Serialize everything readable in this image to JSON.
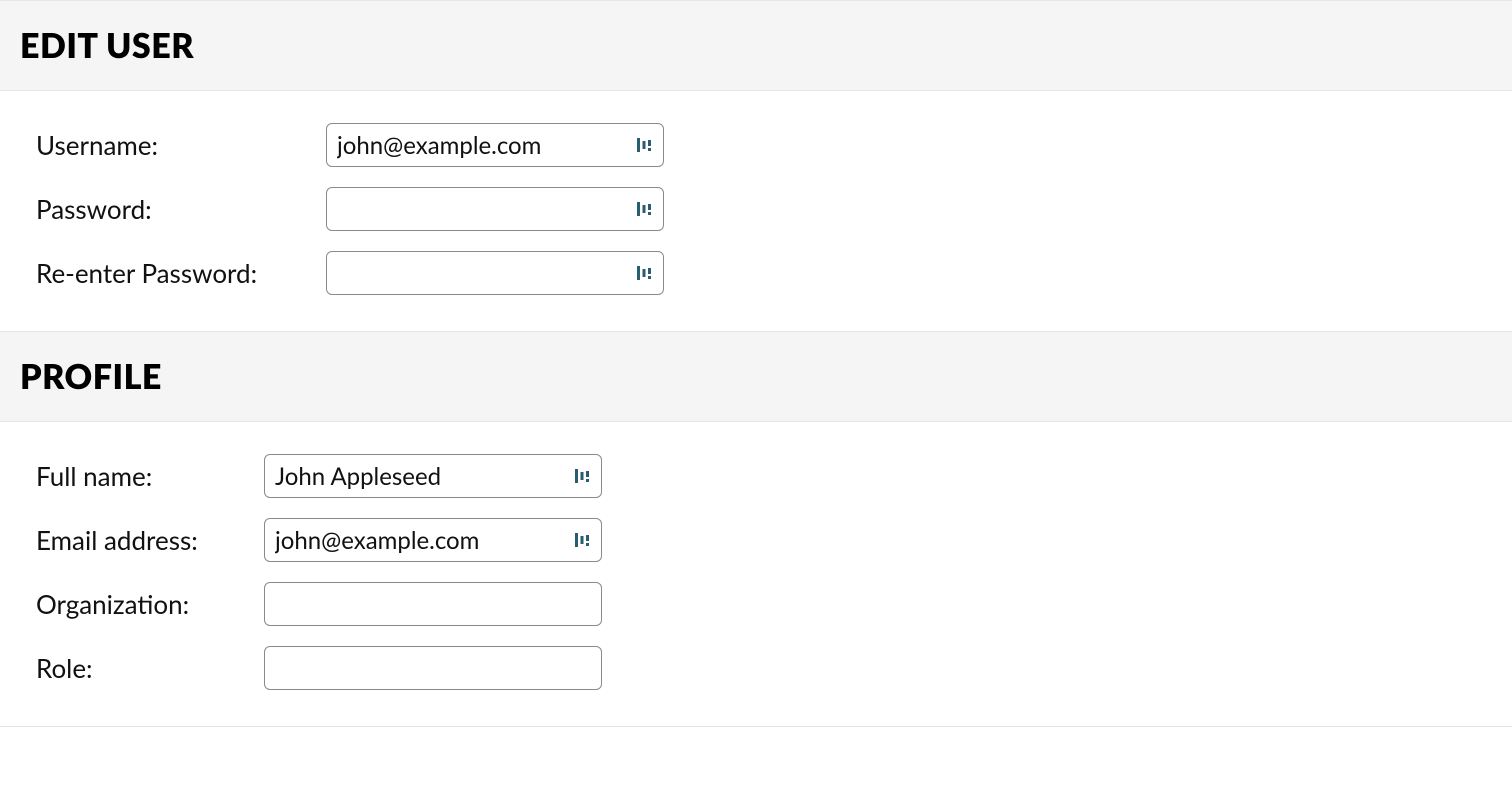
{
  "sections": {
    "edit_user": {
      "heading": "EDIT USER",
      "fields": {
        "username": {
          "label": "Username:",
          "value": "john@example.com"
        },
        "password": {
          "label": "Password:",
          "value": ""
        },
        "reenter_password": {
          "label": "Re-enter Password:",
          "value": ""
        }
      }
    },
    "profile": {
      "heading": "PROFILE",
      "fields": {
        "full_name": {
          "label": "Full name:",
          "value": "John Appleseed"
        },
        "email": {
          "label": "Email address:",
          "value": "john@example.com"
        },
        "organization": {
          "label": "Organization:",
          "value": ""
        },
        "role": {
          "label": "Role:",
          "value": ""
        }
      }
    }
  },
  "icons": {
    "password_manager": "password-manager-icon"
  },
  "colors": {
    "icon": "#2b5d72",
    "header_bg": "#f5f5f5",
    "border": "#e5e5e5",
    "input_border": "#8a8a8a"
  }
}
